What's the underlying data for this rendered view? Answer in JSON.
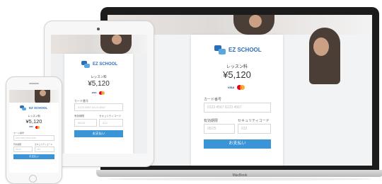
{
  "devices": {
    "laptop_brand": "MacBook"
  },
  "app": {
    "logo_text": "EZ SCHOOL",
    "fee_label": "レッスン料",
    "amount": "¥5,120",
    "card_brands": [
      "VISA",
      "mastercard"
    ],
    "card_number_label": "カード番号",
    "card_number_placeholder": "0123 4567 8123 4567",
    "expiry_label": "有効期限",
    "expiry_placeholder": "05/25",
    "security_label": "セキュリティコード",
    "security_placeholder": "012",
    "pay_button": "お支払い"
  },
  "colors": {
    "accent": "#3a94d6",
    "logo_blue": "#2c6fb6"
  }
}
